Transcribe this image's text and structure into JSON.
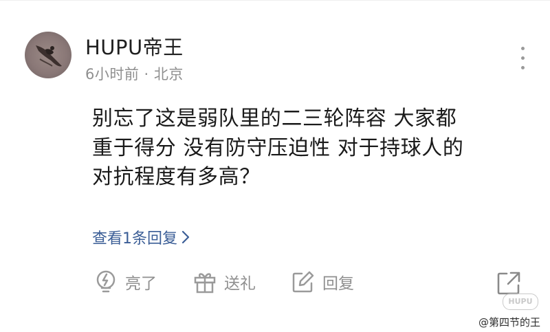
{
  "comment": {
    "username": "HUPU帝王",
    "meta": "6小时前 · 北京",
    "lines": [
      "别忘了这是弱队里的二三轮阵容 大家都",
      "重于得分 没有防守压迫性 对于持球人的",
      "对抗程度有多高？"
    ],
    "view_replies": "查看1条回复"
  },
  "actions": {
    "light_label": "亮了",
    "gift_label": "送礼",
    "reply_label": "回复"
  },
  "watermark": {
    "logo_text": "HUPU",
    "handle": "@第四节的王"
  },
  "colors": {
    "link": "#3a5d96",
    "muted": "#8f8f8f",
    "text": "#1a1a1a"
  },
  "icons": [
    "more-vertical-icon",
    "lightbulb-icon",
    "gift-icon",
    "edit-icon",
    "share-expand-icon",
    "chevron-right-icon"
  ]
}
